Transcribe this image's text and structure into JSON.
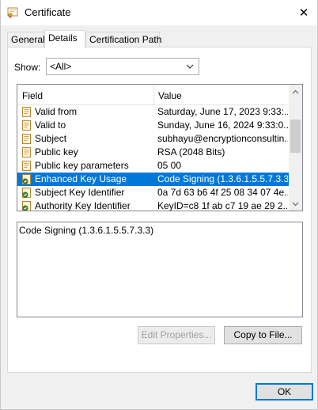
{
  "window": {
    "title": "Certificate",
    "close_glyph": "✕"
  },
  "tabs": [
    {
      "label": "General",
      "active": false
    },
    {
      "label": "Details",
      "active": true
    },
    {
      "label": "Certification Path",
      "active": false
    }
  ],
  "show": {
    "label": "Show:",
    "selected": "<All>"
  },
  "list": {
    "headers": {
      "field": "Field",
      "value": "Value"
    },
    "rows": [
      {
        "field": "Valid from",
        "value": "Saturday, June 17, 2023 9:33:...",
        "icon": "certificate-field-icon"
      },
      {
        "field": "Valid to",
        "value": "Sunday, June 16, 2024 9:33:0...",
        "icon": "certificate-field-icon"
      },
      {
        "field": "Subject",
        "value": "subhayu@encryptionconsultin...",
        "icon": "certificate-field-icon"
      },
      {
        "field": "Public key",
        "value": "RSA (2048 Bits)",
        "icon": "certificate-field-icon"
      },
      {
        "field": "Public key parameters",
        "value": "05 00",
        "icon": "certificate-field-icon"
      },
      {
        "field": "Enhanced Key Usage",
        "value": "Code Signing (1.3.6.1.5.5.7.3.3)",
        "icon": "extension-icon",
        "selected": true
      },
      {
        "field": "Subject Key Identifier",
        "value": "0a 7d 63 b6 4f 25 08 34 07 4e...",
        "icon": "extension-icon"
      },
      {
        "field": "Authority Key Identifier",
        "value": "KeyID=c8 1f ab c7 19 ae 29 2...",
        "icon": "extension-icon"
      }
    ]
  },
  "detail_text": "Code Signing (1.3.6.1.5.5.7.3.3)",
  "buttons": {
    "edit_properties": "Edit Properties...",
    "copy_to_file": "Copy to File...",
    "ok": "OK"
  },
  "colors": {
    "selection": "#0078d7",
    "accent": "#0078d7"
  }
}
